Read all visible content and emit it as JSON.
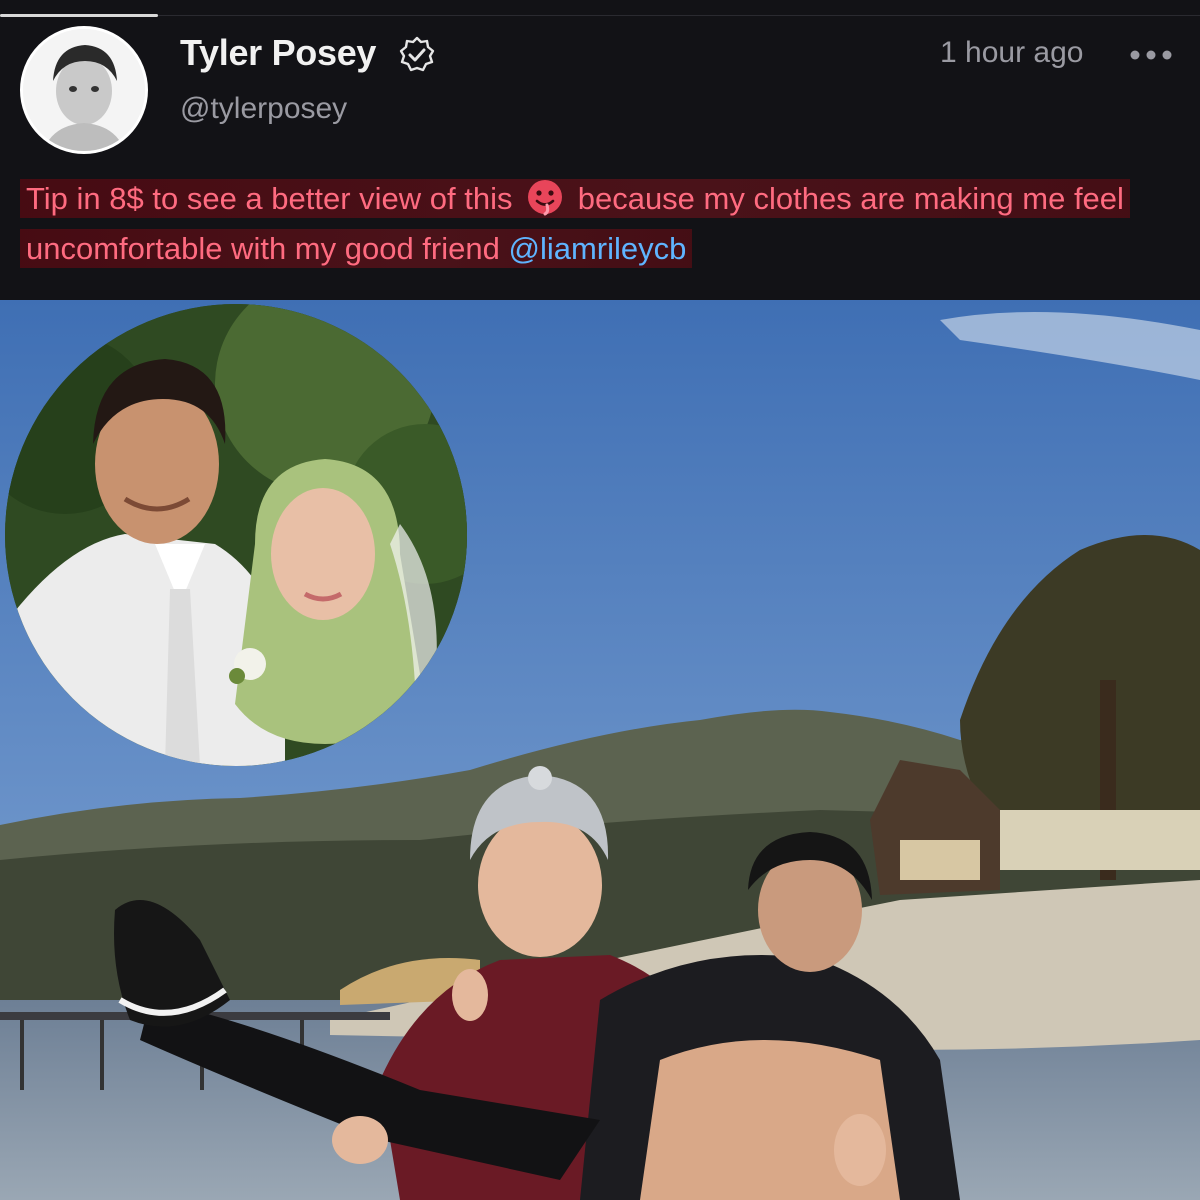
{
  "post": {
    "author": {
      "display_name": "Tyler Posey",
      "handle": "@tylerposey",
      "verified": true
    },
    "timestamp": "1 hour ago",
    "caption": {
      "part1": "Tip in 8$ to see a better view of this",
      "emoji": "drooling-face-icon",
      "part2": "because my clothes are making me feel uncomfortable with my good friend",
      "mention": "@liamrileycb"
    }
  },
  "icons": {
    "verified": "verified-badge-icon",
    "more": "more-options-icon"
  },
  "colors": {
    "background": "#121216",
    "highlight_text": "#ff6b80",
    "mention": "#5fb4ff",
    "secondary_text": "#9a9aa2"
  }
}
